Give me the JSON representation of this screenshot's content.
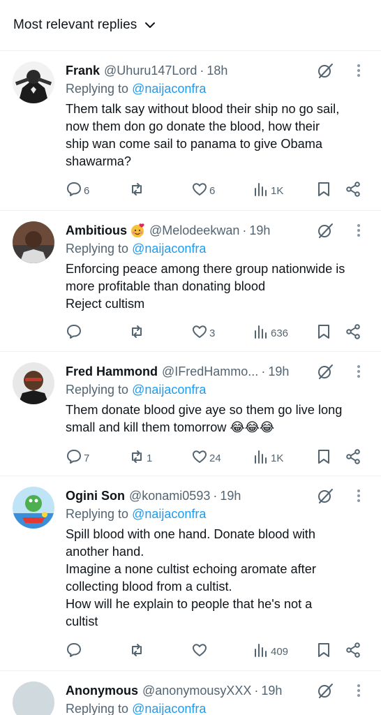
{
  "sort": {
    "label": "Most relevant replies"
  },
  "replies": [
    {
      "name": "Frank",
      "handle": "@Uhuru147Lord",
      "time": "18h",
      "replying_prefix": "Replying to",
      "replying_to": "@naijaconfra",
      "text_lines": [
        "Them talk say without blood their ship no go sail,",
        "now them don go donate the blood, how their",
        "ship wan come sail to panama to give Obama",
        "shawarma?"
      ],
      "replies": "6",
      "reposts": "",
      "likes": "6",
      "views": "1K"
    },
    {
      "name": "Ambitious",
      "handle": "@Melodeekwan",
      "time": "19h",
      "replying_prefix": "Replying to",
      "replying_to": "@naijaconfra",
      "text_lines": [
        "Enforcing peace among there group nationwide is",
        "more profitable than donating blood",
        "Reject cultism"
      ],
      "replies": "",
      "reposts": "",
      "likes": "3",
      "views": "636"
    },
    {
      "name": "Fred Hammond",
      "handle": "@IFredHammo...",
      "time": "19h",
      "replying_prefix": "Replying to",
      "replying_to": "@naijaconfra",
      "text_lines": [
        "Them donate blood give aye so them go live long",
        "small and kill them tomorrow 😂😂😂"
      ],
      "replies": "7",
      "reposts": "1",
      "likes": "24",
      "views": "1K"
    },
    {
      "name": "Ogini Son",
      "handle": "@konami0593",
      "time": "19h",
      "replying_prefix": "Replying to",
      "replying_to": "@naijaconfra",
      "text_lines": [
        "Spill blood with one hand. Donate blood with",
        "another hand.",
        "Imagine a none cultist echoing aromate after",
        "collecting blood from a cultist.",
        "How will he explain to people that he's not a",
        "cultist"
      ],
      "replies": "",
      "reposts": "",
      "likes": "",
      "views": "409"
    },
    {
      "name": "Anonymous",
      "handle": "@anonymousyXXX",
      "time": "19h",
      "replying_prefix": "Replying to",
      "replying_to": "@naijaconfra",
      "text_lines": [],
      "replies": "",
      "reposts": "",
      "likes": "",
      "views": ""
    }
  ],
  "colors": {
    "link": "#1d9bf0",
    "secondary": "#536471",
    "text": "#0f1419",
    "divider": "#eff3f4"
  },
  "icons": [
    "chevron-down-icon",
    "grok-icon",
    "more-icon",
    "reply-icon",
    "repost-icon",
    "like-icon",
    "views-icon",
    "bookmark-icon",
    "share-icon",
    "emoji-icon"
  ]
}
